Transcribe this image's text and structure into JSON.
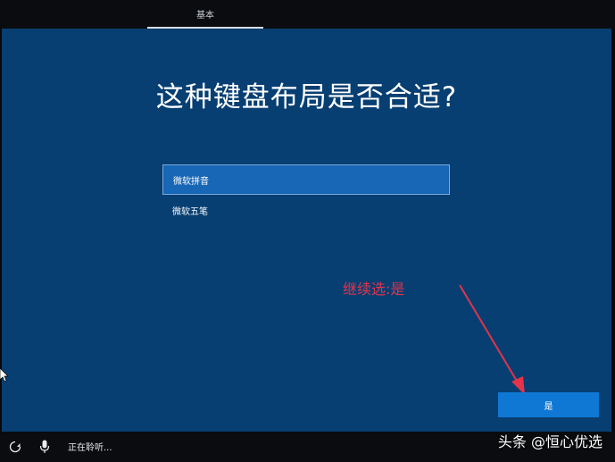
{
  "header": {
    "tab_label": "基本"
  },
  "main": {
    "title": "这种键盘布局是否合适?",
    "options": [
      {
        "label": "微软拼音",
        "selected": true
      },
      {
        "label": "微软五笔",
        "selected": false
      }
    ],
    "annotation": "继续选:是",
    "yes_button_label": "是"
  },
  "bottom_bar": {
    "status_text": "正在聆听...",
    "watermark": "头条 @恒心优选"
  },
  "colors": {
    "background": "#073f72",
    "selected_option": "#1866b6",
    "button": "#0f78d4",
    "annotation": "#e4334b"
  },
  "icons": {
    "accessibility": "accessibility-icon",
    "mic": "microphone-icon",
    "cursor": "mouse-cursor-icon",
    "volume": "volume-icon"
  }
}
